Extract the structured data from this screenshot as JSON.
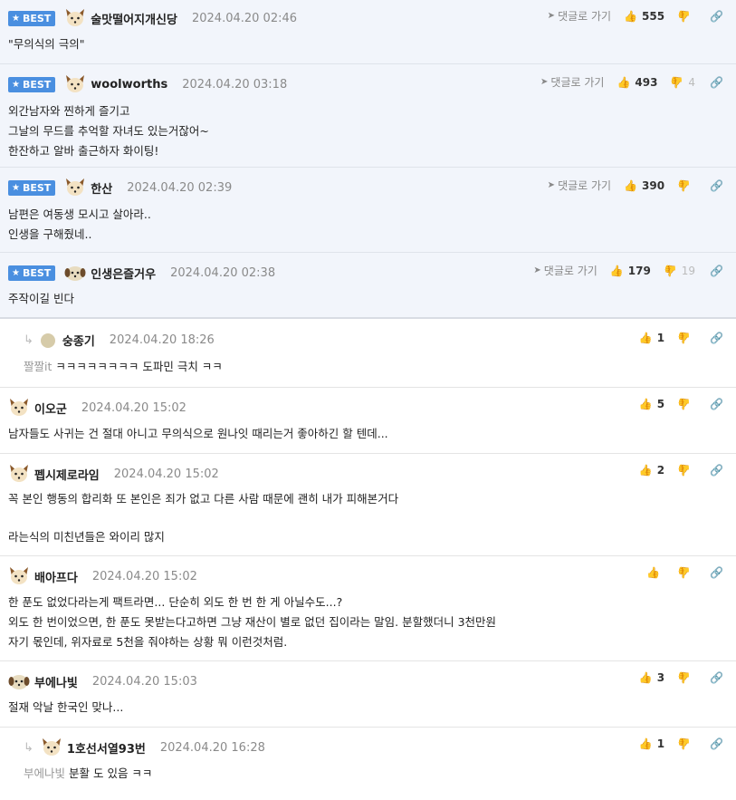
{
  "ui": {
    "best_label": "BEST",
    "goto_label": "댓글로 가기"
  },
  "comments": [
    {
      "best": true,
      "nick": "술맛떨어지개신당",
      "date": "2024.04.20 02:46",
      "likes": "555",
      "dislikes": "",
      "text": "\"무의식의 극의\""
    },
    {
      "best": true,
      "nick": "woolworths",
      "date": "2024.04.20 03:18",
      "likes": "493",
      "dislikes": "4",
      "text": "외간남자와 찐하게 즐기고\n그날의 무드를 추억할 자녀도 있는거잖어~\n한잔하고 알바 출근하자 화이팅!"
    },
    {
      "best": true,
      "nick": "한산",
      "date": "2024.04.20 02:39",
      "likes": "390",
      "dislikes": "",
      "text": "남편은 여동생 모시고 살아라..\n인생을 구해줬네.."
    },
    {
      "best": true,
      "nick": "인생은즐거우",
      "date": "2024.04.20 02:38",
      "likes": "179",
      "dislikes": "19",
      "text": "주작이길 빈다"
    },
    {
      "best": false,
      "reply": true,
      "nick": "숭종기",
      "date": "2024.04.20 18:26",
      "likes": "1",
      "mention": "짤짤it",
      "text": "ㅋㅋㅋㅋㅋㅋㅋㅋ 도파민 극치 ㅋㅋ"
    },
    {
      "best": false,
      "nick": "이오군",
      "date": "2024.04.20 15:02",
      "likes": "5",
      "text": "남자들도 사귀는 건 절대 아니고 무의식으로 원나잇 때리는거 좋아하긴 할 텐데..."
    },
    {
      "best": false,
      "nick": "펩시제로라임",
      "date": "2024.04.20 15:02",
      "likes": "2",
      "text": "꼭 본인 행동의 합리화 또 본인은 죄가 없고 다른 사람 때문에 괜히 내가 피해본거다\n\n라는식의 미친년들은 와이리 많지"
    },
    {
      "best": false,
      "nick": "배아프다",
      "date": "2024.04.20 15:02",
      "likes": "",
      "text": "한 푼도 없었다라는게 팩트라면... 단순히 외도 한 번 한 게 아닐수도...?\n외도 한 번이었으면, 한 푼도 못받는다고하면 그냥 재산이 별로 없던 집이라는 말임. 분할했더니 3천만원\n자기 몫인데, 위자료로 5천을 줘야하는 상황 뭐 이런것처럼."
    },
    {
      "best": false,
      "nick": "부에나빛",
      "date": "2024.04.20 15:03",
      "likes": "3",
      "text": "절재 악날 한국인 맞나..."
    },
    {
      "best": false,
      "reply": true,
      "nick": "1호선서열93번",
      "date": "2024.04.20 16:28",
      "likes": "1",
      "mention": "부에나빛",
      "text": "분활 도 있음 ㅋㅋ"
    }
  ]
}
